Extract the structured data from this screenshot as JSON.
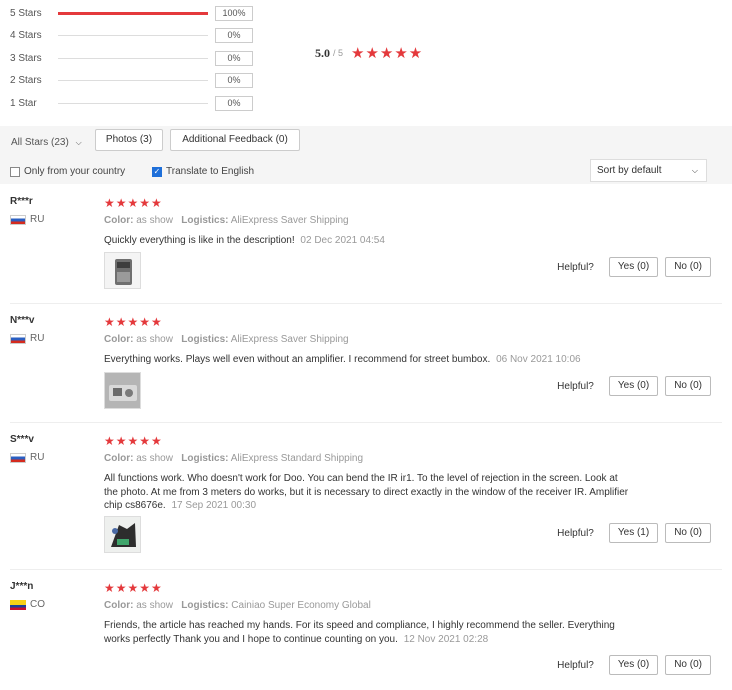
{
  "rating_breakdown": [
    {
      "label": "5 Stars",
      "percent": "100%",
      "fill": 1.0
    },
    {
      "label": "4 Stars",
      "percent": "0%",
      "fill": 0
    },
    {
      "label": "3 Stars",
      "percent": "0%",
      "fill": 0
    },
    {
      "label": "2 Stars",
      "percent": "0%",
      "fill": 0
    },
    {
      "label": "1 Star",
      "percent": "0%",
      "fill": 0
    }
  ],
  "average": {
    "score": "5.0",
    "out_of": "/ 5",
    "stars": "★★★★★"
  },
  "filters": {
    "all_stars": "All Stars (23)",
    "photos": "Photos (3)",
    "additional": "Additional Feedback (0)",
    "only_country": "Only from your country",
    "only_country_checked": false,
    "translate": "Translate to English",
    "translate_checked": true,
    "sort": "Sort by default"
  },
  "helpful_label": "Helpful?",
  "reviews": [
    {
      "user": "R***r",
      "country": "RU",
      "stars": "★★★★★",
      "color_label": "Color:",
      "color": "as show",
      "logistics_label": "Logistics:",
      "logistics": "AliExpress Saver Shipping",
      "text": "Quickly everything is like in the description!",
      "date": "02 Dec 2021 04:54",
      "yes": "Yes (0)",
      "no": "No (0)"
    },
    {
      "user": "N***v",
      "country": "RU",
      "stars": "★★★★★",
      "color_label": "Color:",
      "color": "as show",
      "logistics_label": "Logistics:",
      "logistics": "AliExpress Saver Shipping",
      "text": "Everything works. Plays well even without an amplifier. I recommend for street bumbox.",
      "date": "06 Nov 2021 10:06",
      "yes": "Yes (0)",
      "no": "No (0)"
    },
    {
      "user": "S***v",
      "country": "RU",
      "stars": "★★★★★",
      "color_label": "Color:",
      "color": "as show",
      "logistics_label": "Logistics:",
      "logistics": "AliExpress Standard Shipping",
      "text": "All functions work. Who doesn't work for Doo. You can bend the IR ir1. To the level of rejection in the screen. Look at the photo. At me from 3 meters do works, but it is necessary to direct exactly in the window of the receiver IR. Amplifier chip cs8676e.",
      "date": "17 Sep 2021 00:30",
      "yes": "Yes (1)",
      "no": "No (0)"
    },
    {
      "user": "J***n",
      "country": "CO",
      "stars": "★★★★★",
      "color_label": "Color:",
      "color": "as show",
      "logistics_label": "Logistics:",
      "logistics": "Cainiao Super Economy Global",
      "text": "Friends, the article has reached my hands. For its speed and compliance, I highly recommend the seller. Everything works perfectly Thank you and I hope to continue counting on you.",
      "date": "12 Nov 2021 02:28",
      "yes": "Yes (0)",
      "no": "No (0)"
    }
  ]
}
